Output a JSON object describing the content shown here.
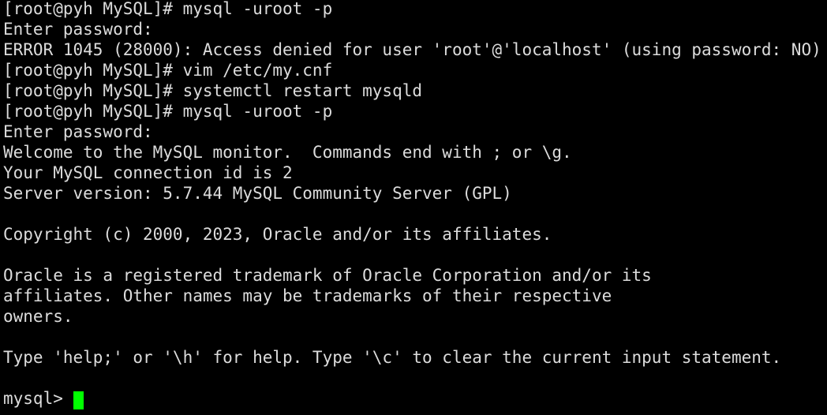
{
  "terminal": {
    "background_color": "#000000",
    "foreground_color": "#dcdcdc",
    "cursor_color": "#00ff00",
    "lines": [
      {
        "text": "[root@pyh MySQL]# mysql -uroot -p",
        "blank": false
      },
      {
        "text": "Enter password:",
        "blank": false
      },
      {
        "text": "ERROR 1045 (28000): Access denied for user 'root'@'localhost' (using password: NO)",
        "blank": false
      },
      {
        "text": "[root@pyh MySQL]# vim /etc/my.cnf",
        "blank": false
      },
      {
        "text": "[root@pyh MySQL]# systemctl restart mysqld",
        "blank": false
      },
      {
        "text": "[root@pyh MySQL]# mysql -uroot -p",
        "blank": false
      },
      {
        "text": "Enter password:",
        "blank": false
      },
      {
        "text": "Welcome to the MySQL monitor.  Commands end with ; or \\g.",
        "blank": false
      },
      {
        "text": "Your MySQL connection id is 2",
        "blank": false
      },
      {
        "text": "Server version: 5.7.44 MySQL Community Server (GPL)",
        "blank": false
      },
      {
        "text": "",
        "blank": true
      },
      {
        "text": "Copyright (c) 2000, 2023, Oracle and/or its affiliates.",
        "blank": false
      },
      {
        "text": "",
        "blank": true
      },
      {
        "text": "Oracle is a registered trademark of Oracle Corporation and/or its",
        "blank": false
      },
      {
        "text": "affiliates. Other names may be trademarks of their respective",
        "blank": false
      },
      {
        "text": "owners.",
        "blank": false
      },
      {
        "text": "",
        "blank": true
      },
      {
        "text": "Type 'help;' or '\\h' for help. Type '\\c' to clear the current input statement.",
        "blank": false
      },
      {
        "text": "",
        "blank": true
      }
    ],
    "prompt": {
      "text": "mysql> ",
      "cursor_visible": true
    }
  }
}
